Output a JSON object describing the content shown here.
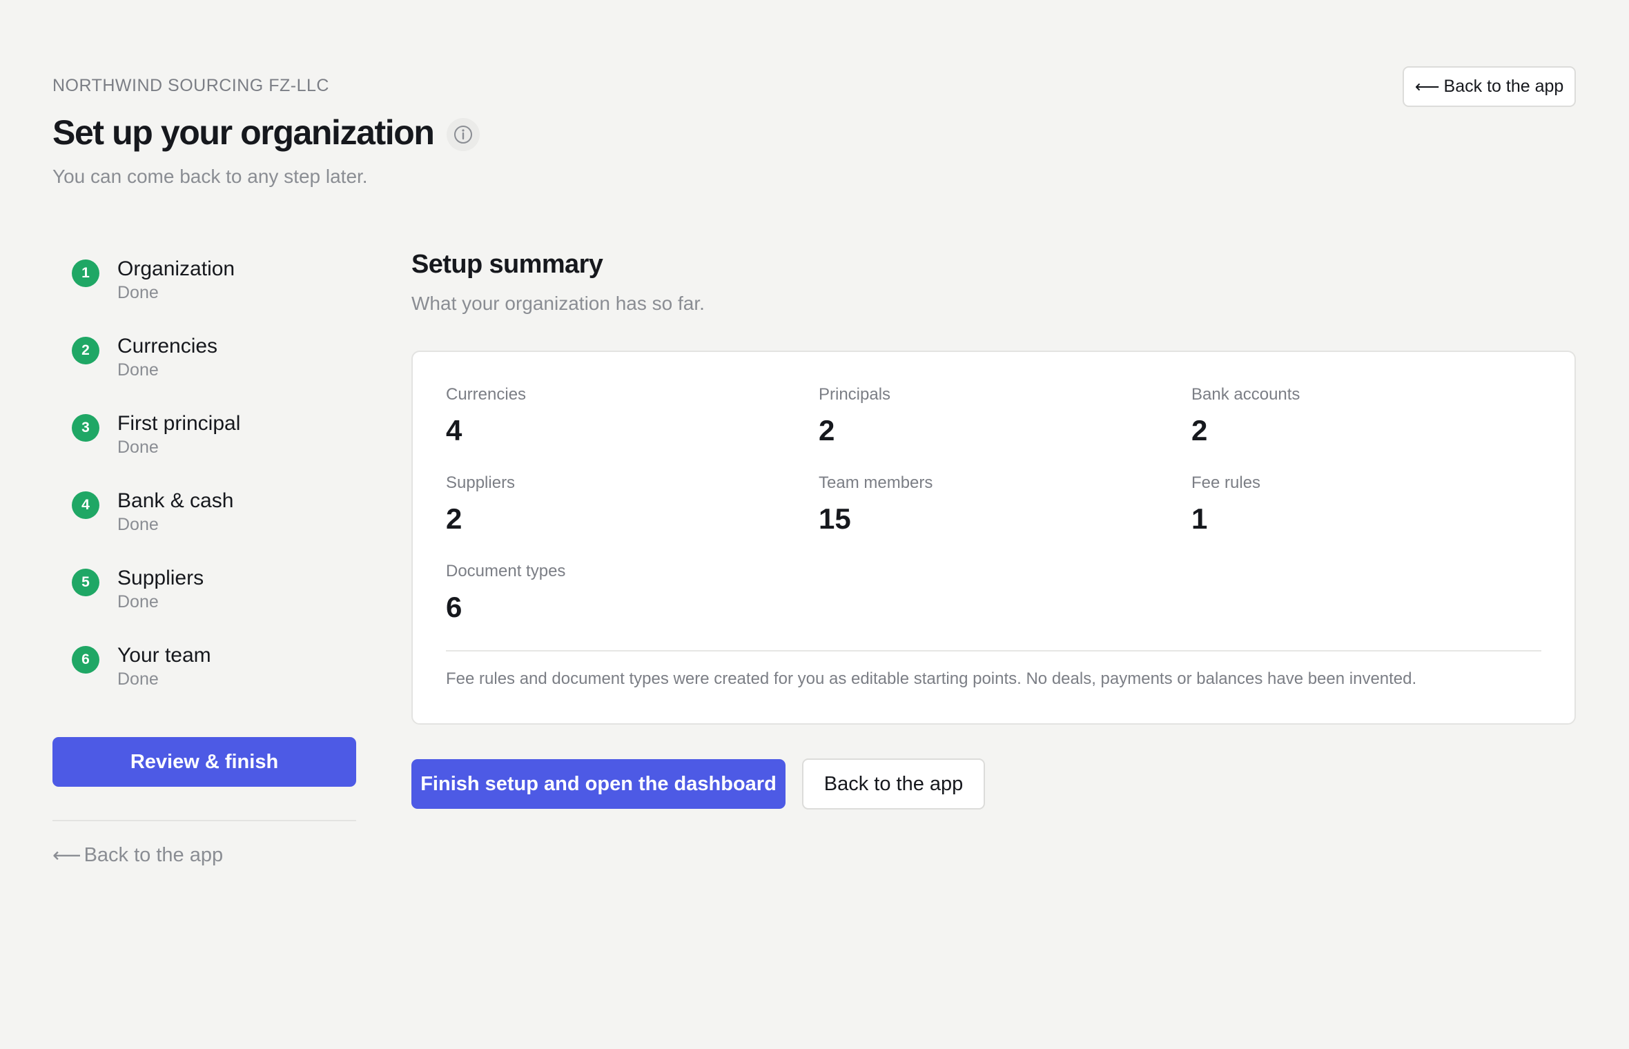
{
  "header": {
    "org_name": "NORTHWIND SOURCING FZ-LLC",
    "title": "Set up your organization",
    "subtitle": "You can come back to any step later.",
    "back_arrow": "⟵",
    "back_label": "Back to the app"
  },
  "steps": [
    {
      "number": "1",
      "label": "Organization",
      "status": "Done"
    },
    {
      "number": "2",
      "label": "Currencies",
      "status": "Done"
    },
    {
      "number": "3",
      "label": "First principal",
      "status": "Done"
    },
    {
      "number": "4",
      "label": "Bank & cash",
      "status": "Done"
    },
    {
      "number": "5",
      "label": "Suppliers",
      "status": "Done"
    },
    {
      "number": "6",
      "label": "Your team",
      "status": "Done"
    }
  ],
  "sidebar": {
    "review_label": "Review & finish",
    "back_arrow": "⟵",
    "back_label": "Back to the app"
  },
  "summary": {
    "title": "Setup summary",
    "subtitle": "What your organization has so far.",
    "stats": [
      {
        "label": "Currencies",
        "value": "4"
      },
      {
        "label": "Principals",
        "value": "2"
      },
      {
        "label": "Bank accounts",
        "value": "2"
      },
      {
        "label": "Suppliers",
        "value": "2"
      },
      {
        "label": "Team members",
        "value": "15"
      },
      {
        "label": "Fee rules",
        "value": "1"
      },
      {
        "label": "Document types",
        "value": "6"
      }
    ],
    "note": "Fee rules and document types were created for you as editable starting points. No deals, payments or balances have been invented."
  },
  "actions": {
    "finish_label": "Finish setup and open the dashboard",
    "back_label": "Back to the app"
  },
  "colors": {
    "accent": "#4d5ae5",
    "success": "#1fa765",
    "background": "#f4f4f2"
  },
  "icons": {
    "info": "info-icon",
    "back": "arrow-left-icon"
  }
}
